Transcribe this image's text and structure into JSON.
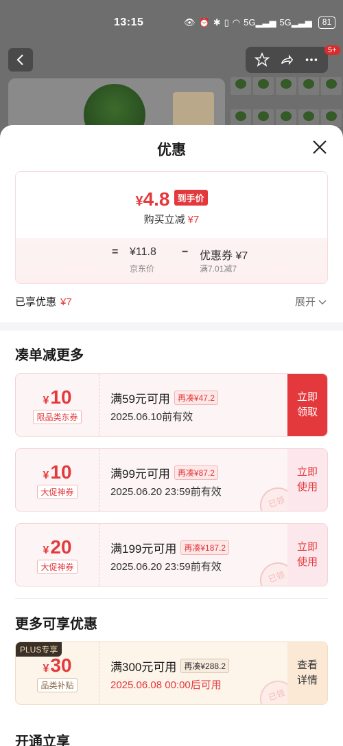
{
  "status_bar": {
    "time": "13:15",
    "battery": "81",
    "signal1": "5G",
    "signal2": "5G"
  },
  "header": {
    "cart_badge": "5+"
  },
  "sheet": {
    "title": "优惠",
    "summary": {
      "final_price_symbol": "¥",
      "final_price": "4.8",
      "final_tag": "到手价",
      "reduce_label": "购买立减",
      "reduce_amount": "¥7",
      "equals": "=",
      "jd_price": "¥11.8",
      "jd_price_label": "京东价",
      "minus": "−",
      "coupon_label": "优惠券 ¥7",
      "coupon_detail": "满7.01减7"
    },
    "enjoyed_label": "已享优惠",
    "enjoyed_amount": "¥7",
    "expand_label": "展开"
  },
  "sections": {
    "combine_title": "凑单减更多",
    "more_title": "更多可享优惠",
    "open_title": "开通立享"
  },
  "coupons": [
    {
      "yen": "¥",
      "amount": "10",
      "type": "限品类东券",
      "condition": "满59元可用",
      "more": "再凑¥47.2",
      "valid": "2025.06.10前有效",
      "action_line1": "立即",
      "action_line2": "领取"
    },
    {
      "yen": "¥",
      "amount": "10",
      "type": "大促神券",
      "condition": "满99元可用",
      "more": "再凑¥87.2",
      "valid": "2025.06.20 23:59前有效",
      "action_line1": "立即",
      "action_line2": "使用",
      "stamp": "已领"
    },
    {
      "yen": "¥",
      "amount": "20",
      "type": "大促神券",
      "condition": "满199元可用",
      "more": "再凑¥187.2",
      "valid": "2025.06.20 23:59前有效",
      "action_line1": "立即",
      "action_line2": "使用",
      "stamp": "已领"
    },
    {
      "plus_tag": "PLUS专享",
      "yen": "¥",
      "amount": "30",
      "type": "品类补贴",
      "condition": "满300元可用",
      "more": "再凑¥288.2",
      "valid": "2025.06.08 00:00后可用",
      "action_line1": "查看",
      "action_line2": "详情",
      "stamp": "已领"
    }
  ],
  "colors": {
    "accent": "#e4393c",
    "plus_bg": "#fdf4ea"
  }
}
